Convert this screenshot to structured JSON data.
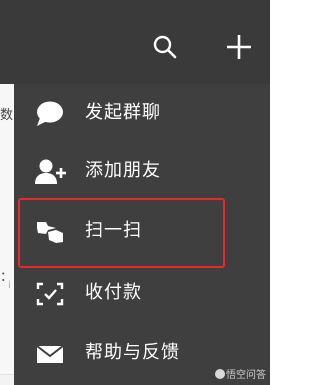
{
  "topbar": {
    "background": "#3a3a3a",
    "icons": [
      "search-icon",
      "plus-icon"
    ]
  },
  "background_list": {
    "chars": [
      "数",
      "：",
      "i"
    ]
  },
  "menu": {
    "background": "#3f3f3f",
    "items": [
      {
        "label": "发起群聊",
        "icon": "chat-bubble-icon"
      },
      {
        "label": "添加朋友",
        "icon": "add-friend-icon"
      },
      {
        "label": "扫一扫",
        "icon": "scan-icon"
      },
      {
        "label": "收付款",
        "icon": "payment-icon"
      },
      {
        "label": "帮助与反馈",
        "icon": "mail-icon"
      }
    ]
  },
  "highlight": {
    "color": "#e8282f",
    "target": "扫一扫"
  },
  "watermark": {
    "text": "悟空问答"
  }
}
